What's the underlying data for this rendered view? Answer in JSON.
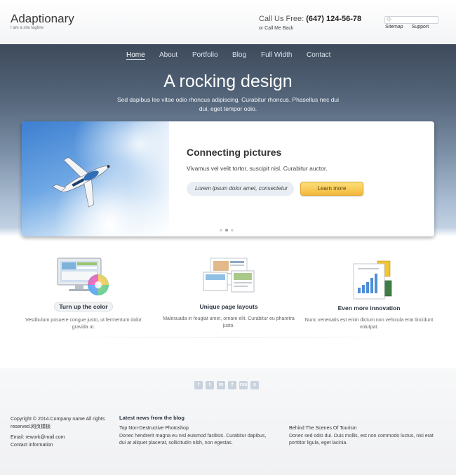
{
  "header": {
    "logo": "Adaptionary",
    "tagline": "I am a site tagline",
    "call_label": "Call Us Free:",
    "call_number": "(647) 124-56-78",
    "callback": "or Call Me Back",
    "search_placeholder": "Q-",
    "links": [
      "Sitemap",
      "Support"
    ]
  },
  "nav": {
    "items": [
      "Home",
      "About",
      "Portfolio",
      "Blog",
      "Full Width",
      "Contact"
    ],
    "active": "Home"
  },
  "hero": {
    "headline": "A rocking design",
    "subtext": "Sed dapibus leo vitae odio rhoncus adipiscing. Curabitur rhoncus. Phasellus nec dui dui, eget tempor odio."
  },
  "slider": {
    "title": "Connecting pictures",
    "text": "Vivamus vel velit tortor, suscipit nisl. Curabitur auctor.",
    "pill": "Lorem ipsum dolor amet, consectetur",
    "button": "Learn more",
    "dots_count": 3,
    "active_dot": 2
  },
  "features": [
    {
      "title": "Turn up the color",
      "desc": "Vestibulum posuere congue justo, ut fermentum dolor gravida ut.",
      "icon": "color-monitor-icon"
    },
    {
      "title": "Unique page layouts",
      "desc": "Malesuada in feugiat amet, ornare elit. Curabitur eu pharetra justo.",
      "icon": "page-layouts-icon"
    },
    {
      "title": "Even more innovation",
      "desc": "Nunc venenatis est enim dictum non vehicula erat tincidunt volutpat.",
      "icon": "innovation-chart-icon"
    }
  ],
  "footer": {
    "social": [
      "f",
      "t",
      "in",
      "f",
      "rss",
      "s"
    ],
    "copyright": "Copyright © 2014.Company name All rights reserved.网页模板",
    "email": "Email: rework@mail.com",
    "contact": "Contact information",
    "news_heading": "Latest news from the blog",
    "news": [
      {
        "title": "Top Non-Destructive Photoshop",
        "text": "Donec hendrerit magna eu nisl euismod facilisis. Curabitur dapibus, dui at aliquet placerat, sollicitudin nibh, non egestas."
      },
      {
        "title": "Behind The Scenes Of Tourism",
        "text": "Donec sed odio dui. Duis mollis, est non commodo luctus, nisi erat porttitor ligula, eget lacinia."
      }
    ]
  },
  "colors": {
    "accent_button": "#f3b73a",
    "hero_dark": "#3d4a5b",
    "hero_light": "#c2d2e4"
  }
}
